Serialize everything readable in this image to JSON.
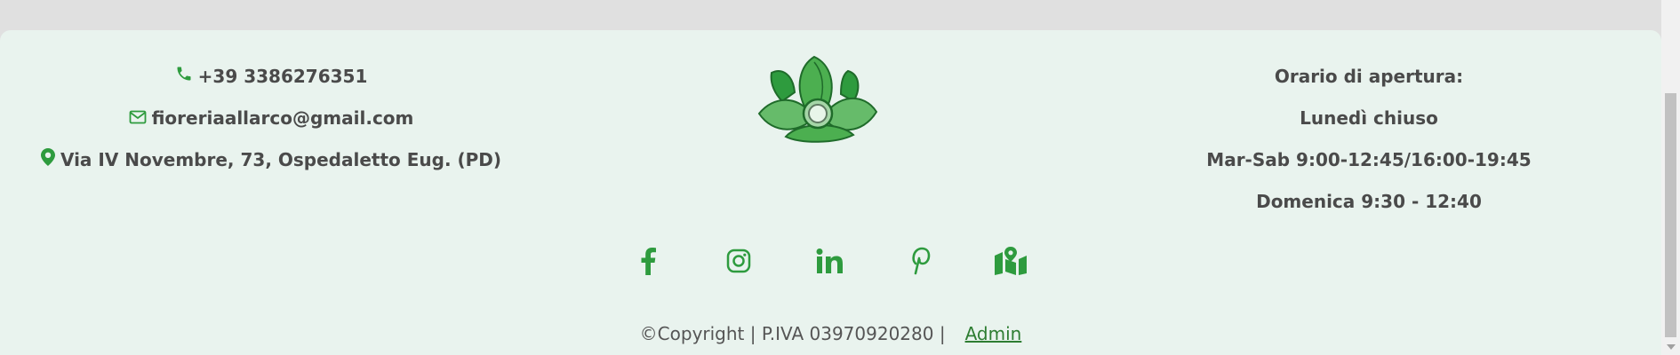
{
  "contacts": {
    "phone": "+39 3386276351",
    "email": "fioreriaallarco@gmail.com",
    "address": "Via IV Novembre, 73, Ospedaletto Eug. (PD)"
  },
  "hours": {
    "title": "Orario di apertura:",
    "monday": "Lunedì chiuso",
    "weekdays": "Mar-Sab 9:00-12:45/16:00-19:45",
    "sunday": "Domenica 9:30 - 12:40"
  },
  "social": {
    "icons": [
      "facebook-icon",
      "instagram-icon",
      "linkedin-icon",
      "pinterest-icon",
      "map-icon"
    ]
  },
  "footer": {
    "copyright": "©Copyright | P.IVA 03970920280 |",
    "admin_label": "Admin"
  },
  "colors": {
    "accent": "#2e9b3e",
    "background": "#e9f3ee",
    "text": "#4a4a4a"
  }
}
